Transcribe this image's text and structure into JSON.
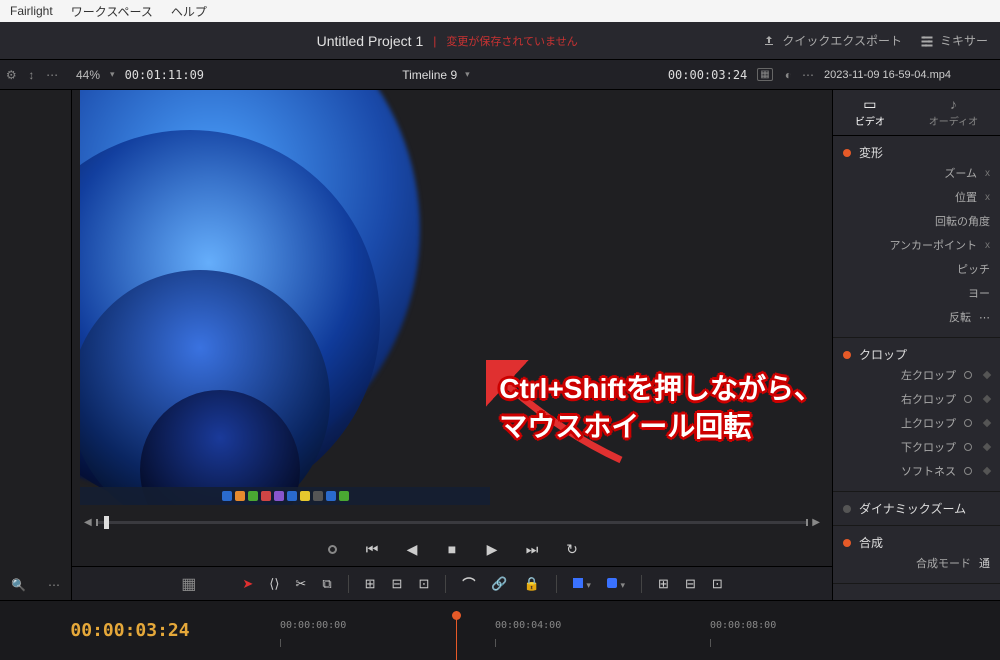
{
  "menu": {
    "items": [
      "Fairlight",
      "ワークスペース",
      "ヘルプ"
    ]
  },
  "header": {
    "project_title": "Untitled Project 1",
    "unsaved_notice": "変更が保存されていません",
    "quick_export": "クイックエクスポート",
    "mixer": "ミキサー"
  },
  "info": {
    "zoom": "44%",
    "source_tc": "00:01:11:09",
    "timeline_name": "Timeline 9",
    "record_tc": "00:00:03:24",
    "clip_filename": "2023-11-09 16-59-04.mp4"
  },
  "inspector": {
    "tabs": {
      "video": "ビデオ",
      "audio": "オーディオ"
    },
    "transform": {
      "title": "変形",
      "zoom": "ズーム",
      "position": "位置",
      "rotation": "回転の角度",
      "anchor": "アンカーポイント",
      "pitch": "ピッチ",
      "yaw": "ヨー",
      "flip": "反転"
    },
    "crop": {
      "title": "クロップ",
      "left": "左クロップ",
      "right": "右クロップ",
      "top": "上クロップ",
      "bottom": "下クロップ",
      "softness": "ソフトネス"
    },
    "dynamic_zoom": "ダイナミックズーム",
    "composite": {
      "title": "合成",
      "mode": "合成モード",
      "mode_val": "通"
    }
  },
  "annotation": {
    "line1": "Ctrl+Shiftを押しながら、",
    "line2": "マウスホイール回転"
  },
  "timeline": {
    "current": "00:00:03:24",
    "ticks": [
      "00:00:00:00",
      "00:00:04:00",
      "00:00:08:00"
    ]
  },
  "icons": {
    "export": "export-icon",
    "mixer": "mixer-icon",
    "chevron": "chevron-down-icon",
    "prev": "prev-icon",
    "play_rev": "play-reverse-icon",
    "stop": "stop-icon",
    "play": "play-icon",
    "next": "next-icon",
    "loop": "loop-icon",
    "pointer": "pointer-icon",
    "magnet": "magnet-icon",
    "link": "link-icon",
    "lock": "lock-icon",
    "bypass": "bypass-icon",
    "dots": "more-icon",
    "search": "search-icon"
  },
  "colors": {
    "accent_orange": "#e65a28",
    "warn_red": "#c83232",
    "flag_blue": "#3a72ff",
    "tc_orange": "#e5a83a"
  }
}
